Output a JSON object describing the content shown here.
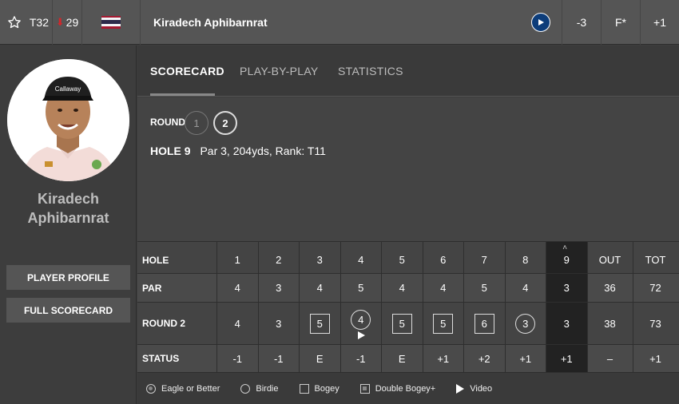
{
  "topbar": {
    "position": "T32",
    "movement": "29",
    "movement_direction": "down",
    "player_name": "Kiradech Aphibarnrat",
    "today": "-3",
    "thru": "F*",
    "total": "+1"
  },
  "sidebar": {
    "player_name_line1": "Kiradech",
    "player_name_line2": "Aphibarnrat",
    "profile_button": "PLAYER PROFILE",
    "scorecard_button": "FULL SCORECARD"
  },
  "tabs": {
    "scorecard": "SCORECARD",
    "playbyplay": "PLAY-BY-PLAY",
    "statistics": "STATISTICS"
  },
  "info": {
    "round_label": "ROUND",
    "round1": "1",
    "round2": "2",
    "hole_label": "HOLE 9",
    "hole_details": "Par 3, 204yds, Rank: T11"
  },
  "scorecard": {
    "labels": {
      "hole": "HOLE",
      "par": "PAR",
      "round": "ROUND 2",
      "status": "STATUS"
    },
    "holes": [
      "1",
      "2",
      "3",
      "4",
      "5",
      "6",
      "7",
      "8",
      "9",
      "OUT",
      "TOT"
    ],
    "par": [
      "4",
      "3",
      "4",
      "5",
      "4",
      "4",
      "5",
      "4",
      "3",
      "36",
      "72"
    ],
    "round": [
      "4",
      "3",
      "5",
      "4",
      "5",
      "5",
      "6",
      "3",
      "3",
      "38",
      "73"
    ],
    "status": [
      "-1",
      "-1",
      "E",
      "-1",
      "E",
      "+1",
      "+2",
      "+1",
      "+1",
      "–",
      "+1"
    ]
  },
  "legend": {
    "eagle": "Eagle or Better",
    "birdie": "Birdie",
    "bogey": "Bogey",
    "double": "Double Bogey+",
    "video": "Video"
  },
  "colors": {
    "flag_red": "#a51931",
    "flag_white": "#f4f5f8",
    "flag_blue": "#2d2a4a",
    "down_arrow": "#d0272c",
    "play_button": "#0d3d7a"
  }
}
